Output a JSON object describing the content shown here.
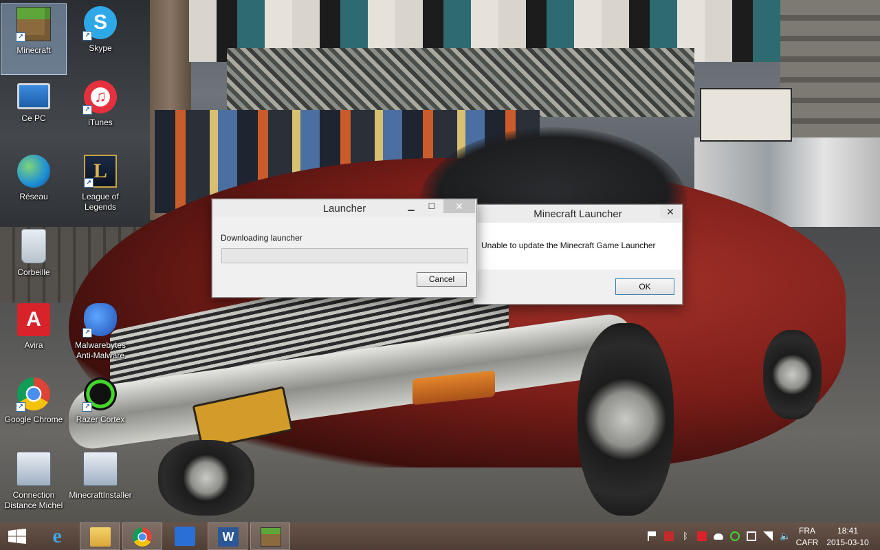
{
  "desktop_icons": [
    {
      "label": "Minecraft",
      "icon": "minecraft-icon"
    },
    {
      "label": "Skype",
      "icon": "skype-icon"
    },
    {
      "label": "Ce PC",
      "icon": "computer-icon"
    },
    {
      "label": "iTunes",
      "icon": "itunes-icon"
    },
    {
      "label": "Réseau",
      "icon": "network-icon"
    },
    {
      "label": "League of Legends",
      "icon": "league-of-legends-icon"
    },
    {
      "label": "Corbeille",
      "icon": "recycle-bin-icon"
    },
    {
      "label": "Avira",
      "icon": "avira-icon"
    },
    {
      "label": "Malwarebytes Anti-Malware",
      "icon": "malwarebytes-icon"
    },
    {
      "label": "Google Chrome",
      "icon": "chrome-icon"
    },
    {
      "label": "Razer Cortex",
      "icon": "razer-cortex-icon"
    },
    {
      "label": "Connection Distance Michel",
      "icon": "remote-desktop-icon"
    },
    {
      "label": "MinecraftInstaller",
      "icon": "installer-icon"
    }
  ],
  "launcher_window": {
    "title": "Launcher",
    "status_text": "Downloading launcher",
    "progress": 0,
    "cancel_label": "Cancel"
  },
  "error_window": {
    "title": "Minecraft Launcher",
    "message": "Unable to update the Minecraft Game Launcher",
    "ok_label": "OK"
  },
  "taskbar": {
    "pinned": [
      "start-button",
      "internet-explorer-icon",
      "file-explorer-icon",
      "chrome-icon",
      "store-app-icon",
      "word-icon",
      "minecraft-icon"
    ],
    "language": "FRA",
    "keyboard": "CAFR",
    "time": "18:41",
    "date": "2015-03-10"
  },
  "colors": {
    "taskbar": "#5c463a",
    "window_bg": "#f0f0f0",
    "accent_selection": "#aacdf0"
  }
}
